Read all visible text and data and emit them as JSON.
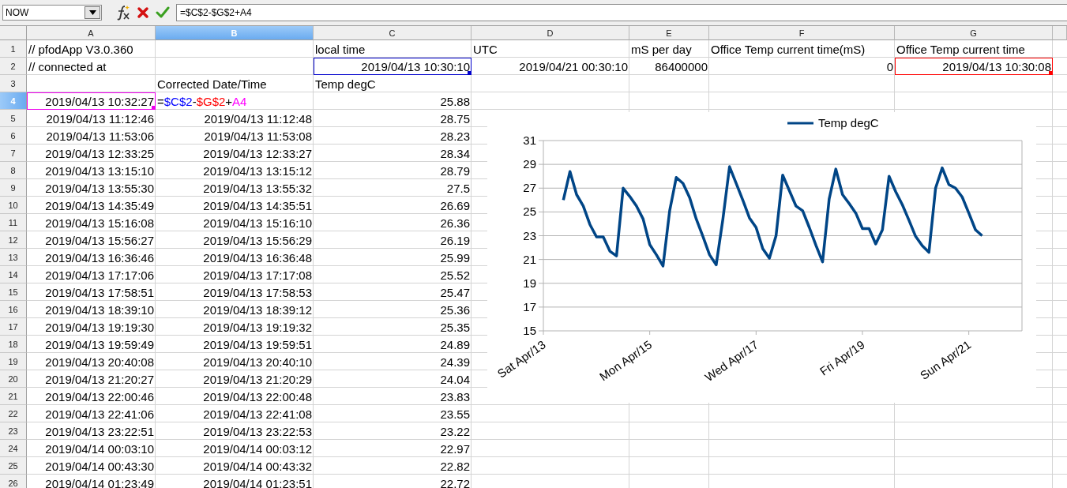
{
  "name_box": {
    "value": "NOW"
  },
  "formula_bar": {
    "value": "=$C$2-$G$2+A4"
  },
  "columns": [
    {
      "label": "A",
      "selected": false
    },
    {
      "label": "B",
      "selected": true
    },
    {
      "label": "C",
      "selected": false
    },
    {
      "label": "D",
      "selected": false
    },
    {
      "label": "E",
      "selected": false
    },
    {
      "label": "F",
      "selected": false
    },
    {
      "label": "G",
      "selected": false
    }
  ],
  "rows": [
    {
      "label": "1",
      "selected": false,
      "cells": [
        {
          "kind": "text",
          "text": "// pfodApp V3.0.360"
        },
        null,
        {
          "kind": "text",
          "text": "local time"
        },
        {
          "kind": "text",
          "text": "UTC"
        },
        {
          "kind": "text",
          "text": "mS per day"
        },
        {
          "kind": "text",
          "text": "Office Temp current time(mS)"
        },
        {
          "kind": "text",
          "text": "Office Temp current time"
        }
      ]
    },
    {
      "label": "2",
      "selected": false,
      "cells": [
        {
          "kind": "text",
          "text": "// connected at"
        },
        null,
        {
          "kind": "value",
          "text": "2019/04/13 10:30:10",
          "color": "#0000cc"
        },
        {
          "kind": "value",
          "text": "2019/04/21 00:30:10"
        },
        {
          "kind": "value",
          "text": "86400000"
        },
        {
          "kind": "value",
          "text": "0"
        },
        {
          "kind": "value",
          "text": "2019/04/13 10:30:08",
          "color": "#ff0000"
        }
      ]
    },
    {
      "label": "3",
      "selected": false,
      "cells": [
        null,
        {
          "kind": "text",
          "text": "Corrected Date/Time"
        },
        {
          "kind": "text",
          "text": "Temp degC"
        },
        null,
        null,
        null,
        null
      ]
    },
    {
      "label": "4",
      "selected": true,
      "cells": [
        {
          "kind": "value",
          "text": "2019/04/13 10:32:27",
          "color": "#ee00ee"
        },
        {
          "kind": "formula",
          "parts": [
            {
              "text": "=",
              "color": "#000000"
            },
            {
              "text": "$C$2",
              "color": "#0000ff"
            },
            {
              "text": "-",
              "color": "#000000"
            },
            {
              "text": "$G$2",
              "color": "#ff0000"
            },
            {
              "text": "+",
              "color": "#000000"
            },
            {
              "text": "A4",
              "color": "#ff00ff"
            }
          ]
        },
        {
          "kind": "value",
          "text": "25.88"
        },
        null,
        null,
        null,
        null
      ]
    },
    {
      "label": "5",
      "selected": false,
      "cells": [
        {
          "kind": "value",
          "text": "2019/04/13 11:12:46"
        },
        {
          "kind": "value",
          "text": "2019/04/13 11:12:48"
        },
        {
          "kind": "value",
          "text": "28.75"
        },
        null,
        null,
        null,
        null
      ]
    },
    {
      "label": "6",
      "selected": false,
      "cells": [
        {
          "kind": "value",
          "text": "2019/04/13 11:53:06"
        },
        {
          "kind": "value",
          "text": "2019/04/13 11:53:08"
        },
        {
          "kind": "value",
          "text": "28.23"
        },
        null,
        null,
        null,
        null
      ]
    },
    {
      "label": "7",
      "selected": false,
      "cells": [
        {
          "kind": "value",
          "text": "2019/04/13 12:33:25"
        },
        {
          "kind": "value",
          "text": "2019/04/13 12:33:27"
        },
        {
          "kind": "value",
          "text": "28.34"
        },
        null,
        null,
        null,
        null
      ]
    },
    {
      "label": "8",
      "selected": false,
      "cells": [
        {
          "kind": "value",
          "text": "2019/04/13 13:15:10"
        },
        {
          "kind": "value",
          "text": "2019/04/13 13:15:12"
        },
        {
          "kind": "value",
          "text": "28.79"
        },
        null,
        null,
        null,
        null
      ]
    },
    {
      "label": "9",
      "selected": false,
      "cells": [
        {
          "kind": "value",
          "text": "2019/04/13 13:55:30"
        },
        {
          "kind": "value",
          "text": "2019/04/13 13:55:32"
        },
        {
          "kind": "value",
          "text": "27.5"
        },
        null,
        null,
        null,
        null
      ]
    },
    {
      "label": "10",
      "selected": false,
      "cells": [
        {
          "kind": "value",
          "text": "2019/04/13 14:35:49"
        },
        {
          "kind": "value",
          "text": "2019/04/13 14:35:51"
        },
        {
          "kind": "value",
          "text": "26.69"
        },
        null,
        null,
        null,
        null
      ]
    },
    {
      "label": "11",
      "selected": false,
      "cells": [
        {
          "kind": "value",
          "text": "2019/04/13 15:16:08"
        },
        {
          "kind": "value",
          "text": "2019/04/13 15:16:10"
        },
        {
          "kind": "value",
          "text": "26.36"
        },
        null,
        null,
        null,
        null
      ]
    },
    {
      "label": "12",
      "selected": false,
      "cells": [
        {
          "kind": "value",
          "text": "2019/04/13 15:56:27"
        },
        {
          "kind": "value",
          "text": "2019/04/13 15:56:29"
        },
        {
          "kind": "value",
          "text": "26.19"
        },
        null,
        null,
        null,
        null
      ]
    },
    {
      "label": "13",
      "selected": false,
      "cells": [
        {
          "kind": "value",
          "text": "2019/04/13 16:36:46"
        },
        {
          "kind": "value",
          "text": "2019/04/13 16:36:48"
        },
        {
          "kind": "value",
          "text": "25.99"
        },
        null,
        null,
        null,
        null
      ]
    },
    {
      "label": "14",
      "selected": false,
      "cells": [
        {
          "kind": "value",
          "text": "2019/04/13 17:17:06"
        },
        {
          "kind": "value",
          "text": "2019/04/13 17:17:08"
        },
        {
          "kind": "value",
          "text": "25.52"
        },
        null,
        null,
        null,
        null
      ]
    },
    {
      "label": "15",
      "selected": false,
      "cells": [
        {
          "kind": "value",
          "text": "2019/04/13 17:58:51"
        },
        {
          "kind": "value",
          "text": "2019/04/13 17:58:53"
        },
        {
          "kind": "value",
          "text": "25.47"
        },
        null,
        null,
        null,
        null
      ]
    },
    {
      "label": "16",
      "selected": false,
      "cells": [
        {
          "kind": "value",
          "text": "2019/04/13 18:39:10"
        },
        {
          "kind": "value",
          "text": "2019/04/13 18:39:12"
        },
        {
          "kind": "value",
          "text": "25.36"
        },
        null,
        null,
        null,
        null
      ]
    },
    {
      "label": "17",
      "selected": false,
      "cells": [
        {
          "kind": "value",
          "text": "2019/04/13 19:19:30"
        },
        {
          "kind": "value",
          "text": "2019/04/13 19:19:32"
        },
        {
          "kind": "value",
          "text": "25.35"
        },
        null,
        null,
        null,
        null
      ]
    },
    {
      "label": "18",
      "selected": false,
      "cells": [
        {
          "kind": "value",
          "text": "2019/04/13 19:59:49"
        },
        {
          "kind": "value",
          "text": "2019/04/13 19:59:51"
        },
        {
          "kind": "value",
          "text": "24.89"
        },
        null,
        null,
        null,
        null
      ]
    },
    {
      "label": "19",
      "selected": false,
      "cells": [
        {
          "kind": "value",
          "text": "2019/04/13 20:40:08"
        },
        {
          "kind": "value",
          "text": "2019/04/13 20:40:10"
        },
        {
          "kind": "value",
          "text": "24.39"
        },
        null,
        null,
        null,
        null
      ]
    },
    {
      "label": "20",
      "selected": false,
      "cells": [
        {
          "kind": "value",
          "text": "2019/04/13 21:20:27"
        },
        {
          "kind": "value",
          "text": "2019/04/13 21:20:29"
        },
        {
          "kind": "value",
          "text": "24.04"
        },
        null,
        null,
        null,
        null
      ]
    },
    {
      "label": "21",
      "selected": false,
      "cells": [
        {
          "kind": "value",
          "text": "2019/04/13 22:00:46"
        },
        {
          "kind": "value",
          "text": "2019/04/13 22:00:48"
        },
        {
          "kind": "value",
          "text": "23.83"
        },
        null,
        null,
        null,
        null
      ]
    },
    {
      "label": "22",
      "selected": false,
      "cells": [
        {
          "kind": "value",
          "text": "2019/04/13 22:41:06"
        },
        {
          "kind": "value",
          "text": "2019/04/13 22:41:08"
        },
        {
          "kind": "value",
          "text": "23.55"
        },
        null,
        null,
        null,
        null
      ]
    },
    {
      "label": "23",
      "selected": false,
      "cells": [
        {
          "kind": "value",
          "text": "2019/04/13 23:22:51"
        },
        {
          "kind": "value",
          "text": "2019/04/13 23:22:53"
        },
        {
          "kind": "value",
          "text": "23.22"
        },
        null,
        null,
        null,
        null
      ]
    },
    {
      "label": "24",
      "selected": false,
      "cells": [
        {
          "kind": "value",
          "text": "2019/04/14 00:03:10"
        },
        {
          "kind": "value",
          "text": "2019/04/14 00:03:12"
        },
        {
          "kind": "value",
          "text": "22.97"
        },
        null,
        null,
        null,
        null
      ]
    },
    {
      "label": "25",
      "selected": false,
      "cells": [
        {
          "kind": "value",
          "text": "2019/04/14 00:43:30"
        },
        {
          "kind": "value",
          "text": "2019/04/14 00:43:32"
        },
        {
          "kind": "value",
          "text": "22.82"
        },
        null,
        null,
        null,
        null
      ]
    },
    {
      "label": "26",
      "selected": false,
      "cells": [
        {
          "kind": "value",
          "text": "2019/04/14 01:23:49"
        },
        {
          "kind": "value",
          "text": "2019/04/14 01:23:51"
        },
        {
          "kind": "value",
          "text": "22.72"
        },
        null,
        null,
        null,
        null
      ]
    }
  ],
  "chart": {
    "chart_data": {
      "type": "line",
      "categories": [
        "Sat Apr/13",
        null,
        null,
        null,
        null,
        null,
        null,
        null,
        null,
        null,
        null,
        null,
        null,
        null,
        null,
        null,
        "Mon Apr/15",
        null,
        null,
        null,
        null,
        null,
        null,
        null,
        null,
        null,
        null,
        null,
        null,
        null,
        null,
        null,
        "Wed Apr/17",
        null,
        null,
        null,
        null,
        null,
        null,
        null,
        null,
        null,
        null,
        null,
        null,
        null,
        null,
        null,
        "Fri Apr/19",
        null,
        null,
        null,
        null,
        null,
        null,
        null,
        null,
        null,
        null,
        null,
        null,
        null,
        null,
        null,
        "Sun Apr/21",
        null,
        null,
        null,
        null,
        null,
        null,
        null,
        null
      ],
      "series": [
        {
          "name": "Temp degC",
          "color": "#004586",
          "values": [
            null,
            null,
            null,
            26.0,
            28.4,
            26.45,
            25.5,
            23.95,
            22.9,
            22.9,
            21.7,
            21.3,
            27.0,
            26.3,
            25.5,
            24.4,
            22.25,
            21.4,
            20.45,
            25.1,
            27.9,
            27.4,
            26.2,
            24.4,
            22.95,
            21.4,
            20.55,
            24.4,
            28.8,
            27.4,
            26.0,
            24.5,
            23.7,
            21.9,
            21.1,
            23.0,
            28.1,
            26.8,
            25.5,
            25.1,
            23.7,
            22.2,
            20.8,
            26.1,
            28.6,
            26.45,
            25.7,
            24.9,
            23.6,
            23.6,
            22.3,
            23.5,
            28.0,
            26.7,
            25.6,
            24.3,
            22.95,
            22.15,
            21.6,
            27.0,
            28.7,
            27.3,
            27.0,
            26.25,
            24.9,
            23.5,
            23.0,
            null,
            null,
            null,
            null,
            null,
            null
          ]
        }
      ],
      "ylim": [
        15,
        31
      ],
      "grid": true,
      "yticks": [
        15,
        17,
        19,
        21,
        23,
        25,
        27,
        29,
        31
      ]
    }
  }
}
